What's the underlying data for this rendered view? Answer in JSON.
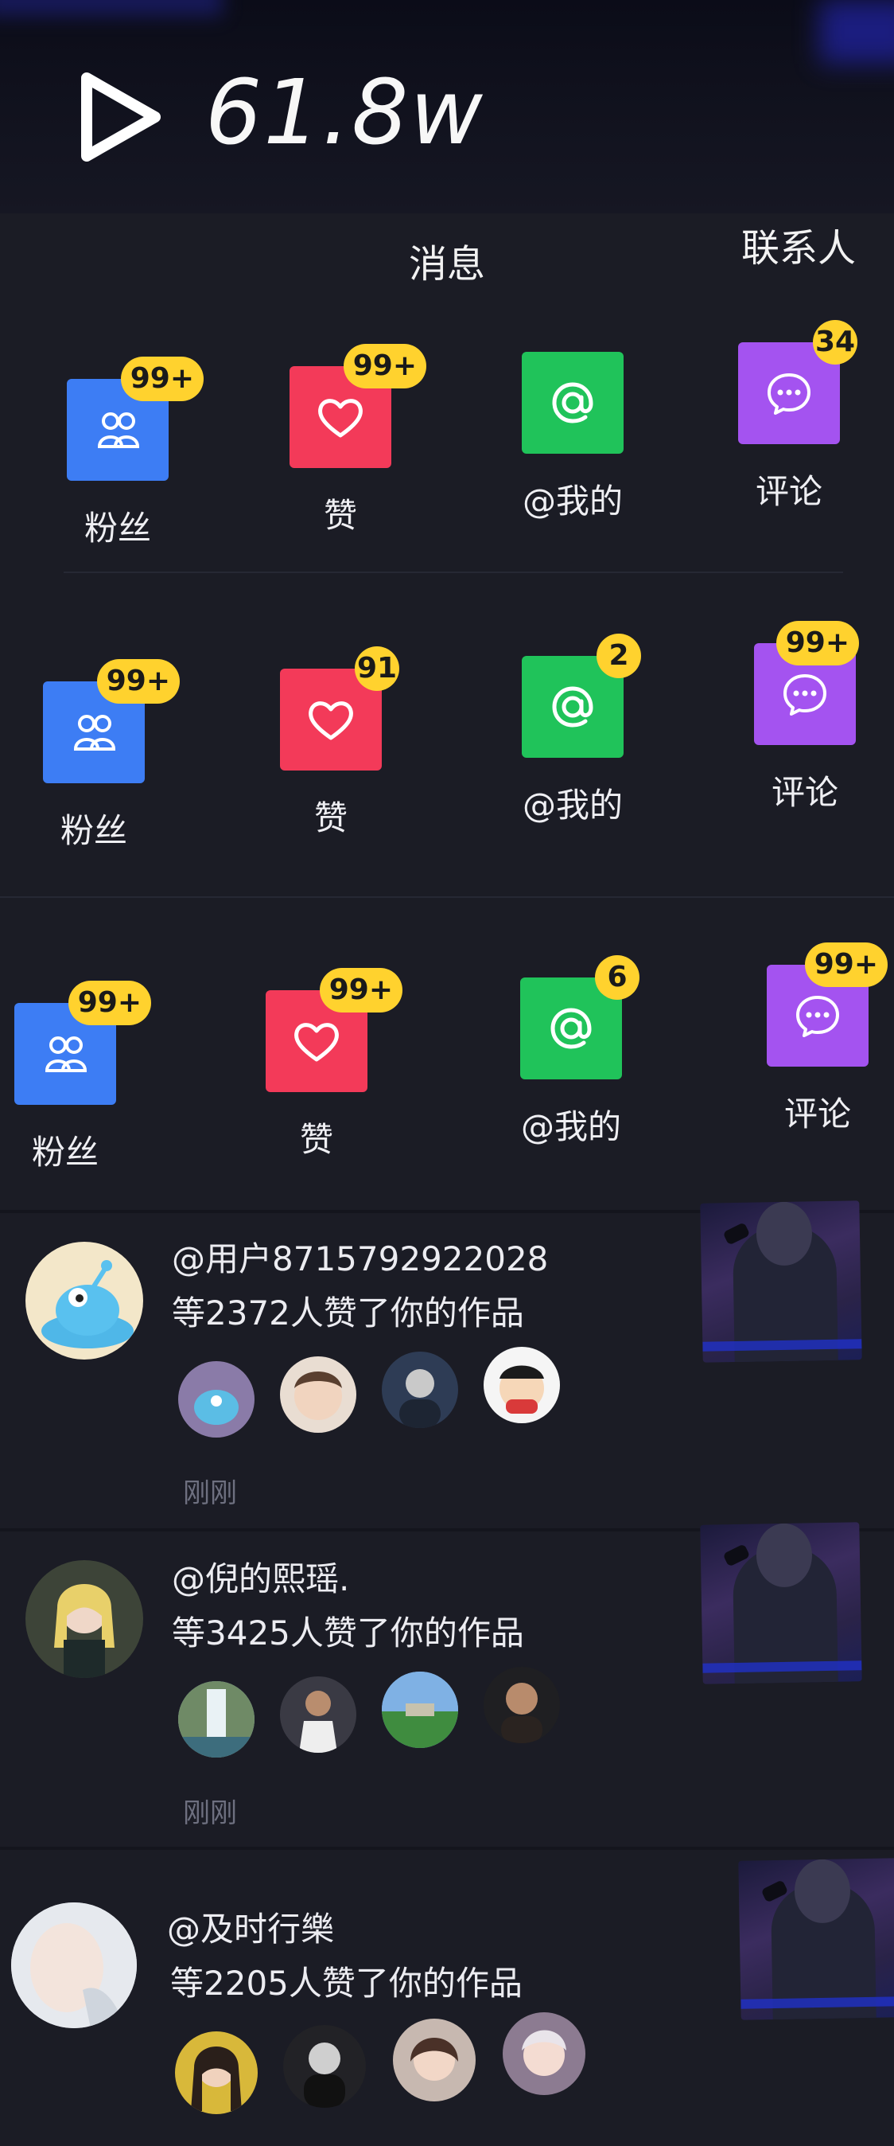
{
  "banner": {
    "play_count": "61.8w"
  },
  "header": {
    "title": "消息",
    "contacts": "联系人"
  },
  "tile_rows": [
    [
      {
        "label": "粉丝",
        "badge": "99+",
        "color": "blue",
        "icon": "fans-icon"
      },
      {
        "label": "赞",
        "badge": "99+",
        "color": "red",
        "icon": "heart-icon"
      },
      {
        "label": "@我的",
        "badge": "",
        "color": "green",
        "icon": "at-icon"
      },
      {
        "label": "评论",
        "badge": "34",
        "color": "purple",
        "icon": "comment-icon"
      }
    ],
    [
      {
        "label": "粉丝",
        "badge": "99+",
        "color": "blue",
        "icon": "fans-icon"
      },
      {
        "label": "赞",
        "badge": "91",
        "color": "red",
        "icon": "heart-icon"
      },
      {
        "label": "@我的",
        "badge": "2",
        "color": "green",
        "icon": "at-icon"
      },
      {
        "label": "评论",
        "badge": "99+",
        "color": "purple",
        "icon": "comment-icon"
      }
    ],
    [
      {
        "label": "粉丝",
        "badge": "99+",
        "color": "blue",
        "icon": "fans-icon"
      },
      {
        "label": "赞",
        "badge": "99+",
        "color": "red",
        "icon": "heart-icon"
      },
      {
        "label": "@我的",
        "badge": "6",
        "color": "green",
        "icon": "at-icon"
      },
      {
        "label": "评论",
        "badge": "99+",
        "color": "purple",
        "icon": "comment-icon"
      }
    ]
  ],
  "feed": [
    {
      "user": "@用户8715792922028",
      "text": "等2372人赞了你的作品",
      "time": "刚刚"
    },
    {
      "user": "@倪的熙瑶.",
      "text": "等3425人赞了你的作品",
      "time": "刚刚"
    },
    {
      "user": "@及时行樂",
      "text": "等2205人赞了你的作品",
      "time": ""
    }
  ],
  "colors": {
    "background": "#1b1c25",
    "badge": "#ffd22e",
    "blue": "#3d7df4",
    "red": "#f33a59",
    "green": "#20c35a",
    "purple": "#a453f0"
  }
}
